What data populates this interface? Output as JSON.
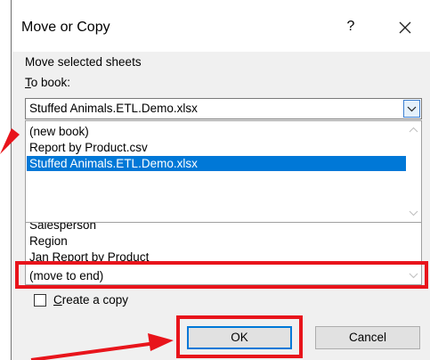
{
  "dialog": {
    "title": "Move or Copy",
    "help_label": "?",
    "section_label": "Move selected sheets",
    "to_book_label": "To book:",
    "to_book_value": "Stuffed Animals.ETL.Demo.xlsx",
    "books": [
      {
        "label": "(new book)"
      },
      {
        "label": "Report by Product.csv"
      },
      {
        "label": "Stuffed Animals.ETL.Demo.xlsx",
        "selected": true
      }
    ],
    "before_sheets": [
      {
        "label": "Salesperson"
      },
      {
        "label": "Region"
      },
      {
        "label": "Jan Report by Product"
      },
      {
        "label": "(move to end)",
        "selected": true
      }
    ],
    "create_copy_label": "Create a copy",
    "create_copy_checked": false,
    "ok_label": "OK",
    "cancel_label": "Cancel"
  },
  "colors": {
    "selection": "#0078d7",
    "annotation_red": "#e8141b",
    "dialog_bg": "#f0f0f0"
  }
}
